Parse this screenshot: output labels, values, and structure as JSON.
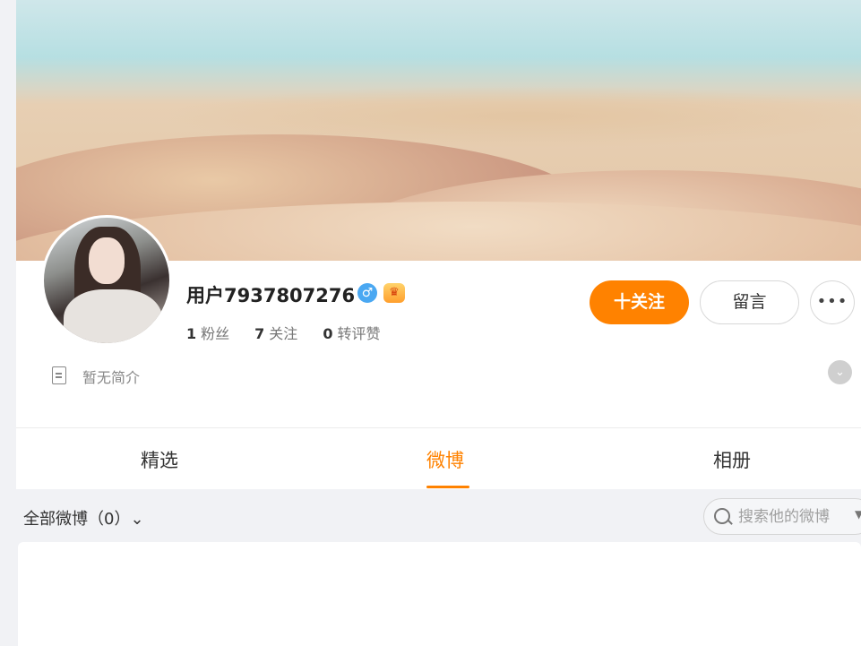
{
  "profile": {
    "username": "用户7937807276",
    "gender_icon": "♂",
    "vip_icon": "♛",
    "stats": [
      {
        "num": "1",
        "label": "粉丝"
      },
      {
        "num": "7",
        "label": "关注"
      },
      {
        "num": "0",
        "label": "转评赞"
      }
    ],
    "intro": "暂无简介"
  },
  "actions": {
    "follow": "十关注",
    "message": "留言",
    "more": "•••",
    "expand": "⌄"
  },
  "tabs": [
    {
      "label": "精选"
    },
    {
      "label": "微博"
    },
    {
      "label": "相册"
    }
  ],
  "filter": {
    "label": "全部微博（0）⌄"
  },
  "search": {
    "placeholder": "搜索他的微博",
    "caret": "▼"
  },
  "colors": {
    "accent": "#ff8200",
    "gender": "#4aa8f2"
  }
}
